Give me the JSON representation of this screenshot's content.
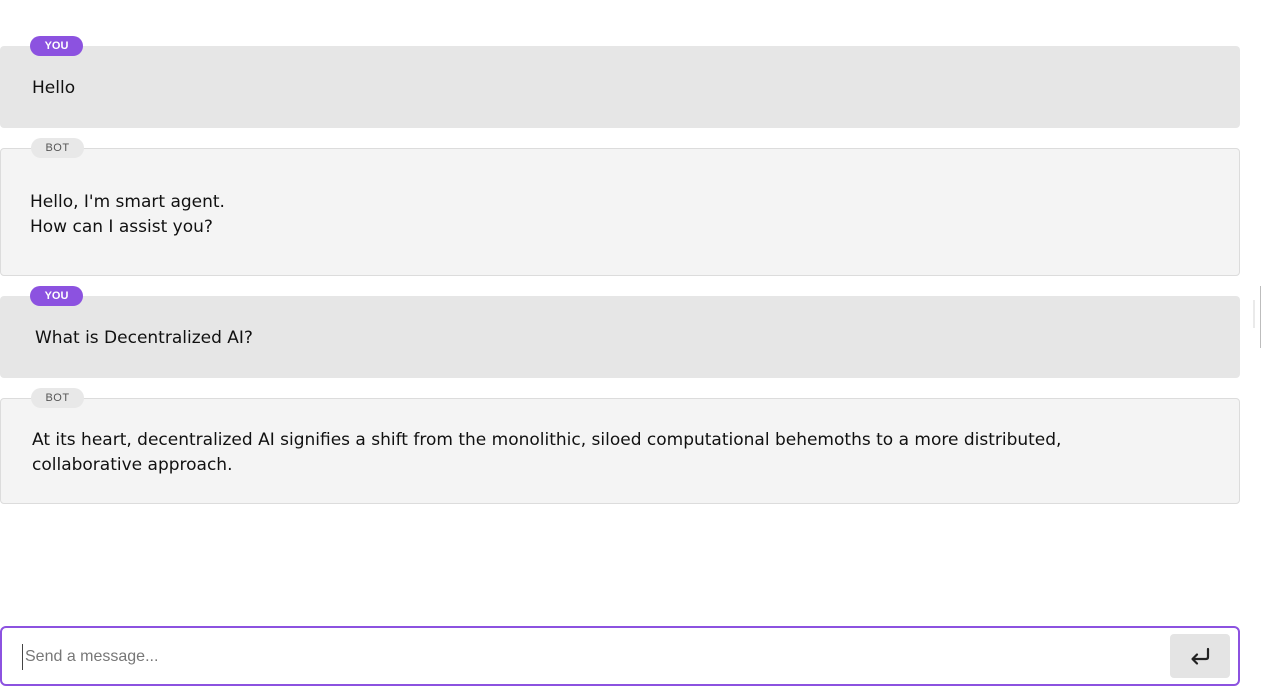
{
  "messages": [
    {
      "role_label": "YOU",
      "text": "Hello"
    },
    {
      "role_label": "BOT",
      "text": "Hello, I'm smart agent.\nHow can I assist you?"
    },
    {
      "role_label": "YOU",
      "text": "What is Decentralized AI?"
    },
    {
      "role_label": "BOT",
      "text": "At its heart, decentralized AI signifies a shift from the monolithic, siloed computational behemoths to a more distributed,\ncollaborative approach."
    }
  ],
  "composer": {
    "placeholder": "Send a message...",
    "value": "",
    "send_icon": "enter-return-icon"
  },
  "colors": {
    "accent": "#8c52e0",
    "user_bubble": "#e6e6e6",
    "bot_bubble": "#f4f4f4"
  }
}
